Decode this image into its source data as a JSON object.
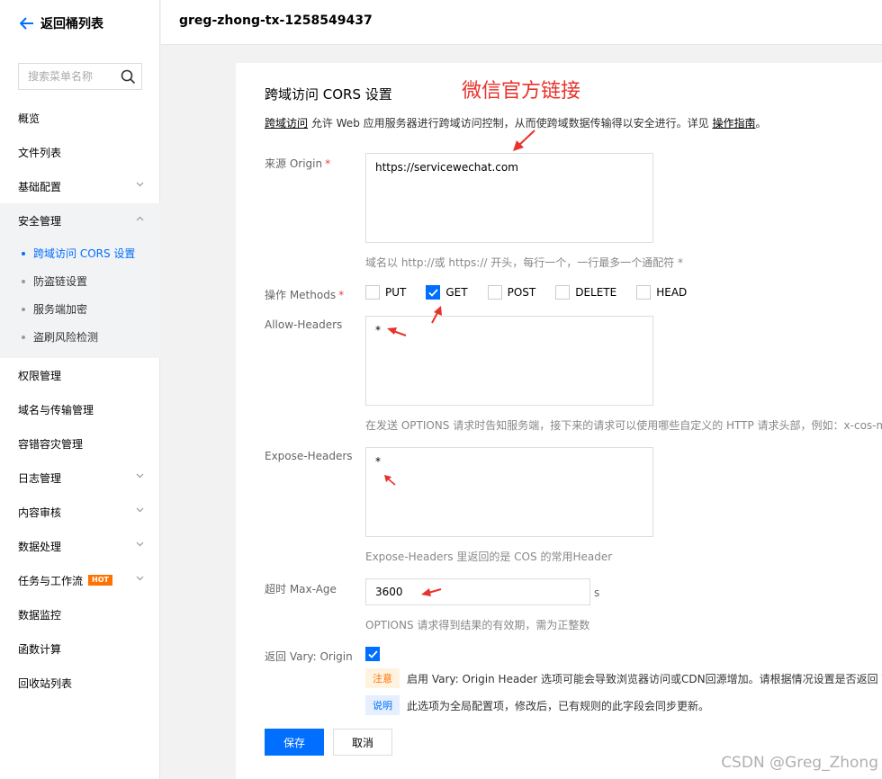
{
  "sidebar": {
    "back_label": "返回桶列表",
    "search_placeholder": "搜索菜单名称",
    "items_top": [
      {
        "label": "概览"
      },
      {
        "label": "文件列表"
      },
      {
        "label": "基础配置",
        "expandable": true
      }
    ],
    "security": {
      "label": "安全管理",
      "children": [
        {
          "label": "跨域访问 CORS 设置",
          "active": true
        },
        {
          "label": "防盗链设置"
        },
        {
          "label": "服务端加密"
        },
        {
          "label": "盗刷风险检测"
        }
      ]
    },
    "items_bottom": [
      {
        "label": "权限管理"
      },
      {
        "label": "域名与传输管理"
      },
      {
        "label": "容错容灾管理"
      },
      {
        "label": "日志管理",
        "expandable": true
      },
      {
        "label": "内容审核",
        "expandable": true
      },
      {
        "label": "数据处理",
        "expandable": true
      },
      {
        "label": "任务与工作流",
        "expandable": true,
        "badge": "HOT"
      },
      {
        "label": "数据监控"
      },
      {
        "label": "函数计算"
      },
      {
        "label": "回收站列表"
      }
    ]
  },
  "header": {
    "bucket_name": "greg-zhong-tx-1258549437"
  },
  "form": {
    "title": "跨域访问 CORS 设置",
    "annotation": "微信官方链接",
    "desc": {
      "link1": "跨域访问",
      "text": " 允许 Web 应用服务器进行跨域访问控制，从而使跨域数据传输得以安全进行。详见 ",
      "link2": "操作指南",
      "suffix": "。"
    },
    "origin": {
      "label": "来源 Origin",
      "required": "*",
      "value": "https://servicewechat.com",
      "hint": "域名以 http://或 https:// 开头，每行一个，一行最多一个通配符 *"
    },
    "methods": {
      "label": "操作 Methods",
      "required": "*",
      "options": [
        {
          "label": "PUT",
          "checked": false
        },
        {
          "label": "GET",
          "checked": true
        },
        {
          "label": "POST",
          "checked": false
        },
        {
          "label": "DELETE",
          "checked": false
        },
        {
          "label": "HEAD",
          "checked": false
        }
      ]
    },
    "allow_headers": {
      "label": "Allow-Headers",
      "value": "*",
      "hint": "在发送 OPTIONS 请求时告知服务端，接下来的请求可以使用哪些自定义的 HTTP 请求头部，例如：x-cos-me"
    },
    "expose_headers": {
      "label": "Expose-Headers",
      "value": "*",
      "hint": "Expose-Headers 里返回的是 COS 的常用Header"
    },
    "max_age": {
      "label": "超时 Max-Age",
      "value": "3600",
      "unit": "s",
      "hint": "OPTIONS 请求得到结果的有效期，需为正整数"
    },
    "vary": {
      "label": "返回 Vary: Origin",
      "checked": true,
      "warn_tag": "注意",
      "warn_text": "启用 Vary: Origin Header 选项可能会导致浏览器访问或CDN回源增加。请根据情况设置是否返回 Vary",
      "info_tag": "说明",
      "info_text": "此选项为全局配置项，修改后，已有规则的此字段会同步更新。"
    },
    "save_label": "保存",
    "cancel_label": "取消"
  },
  "watermark": "CSDN @Greg_Zhong",
  "colors": {
    "accent": "#006eff",
    "annotation": "#e8322c",
    "hot": "#ff7200"
  }
}
